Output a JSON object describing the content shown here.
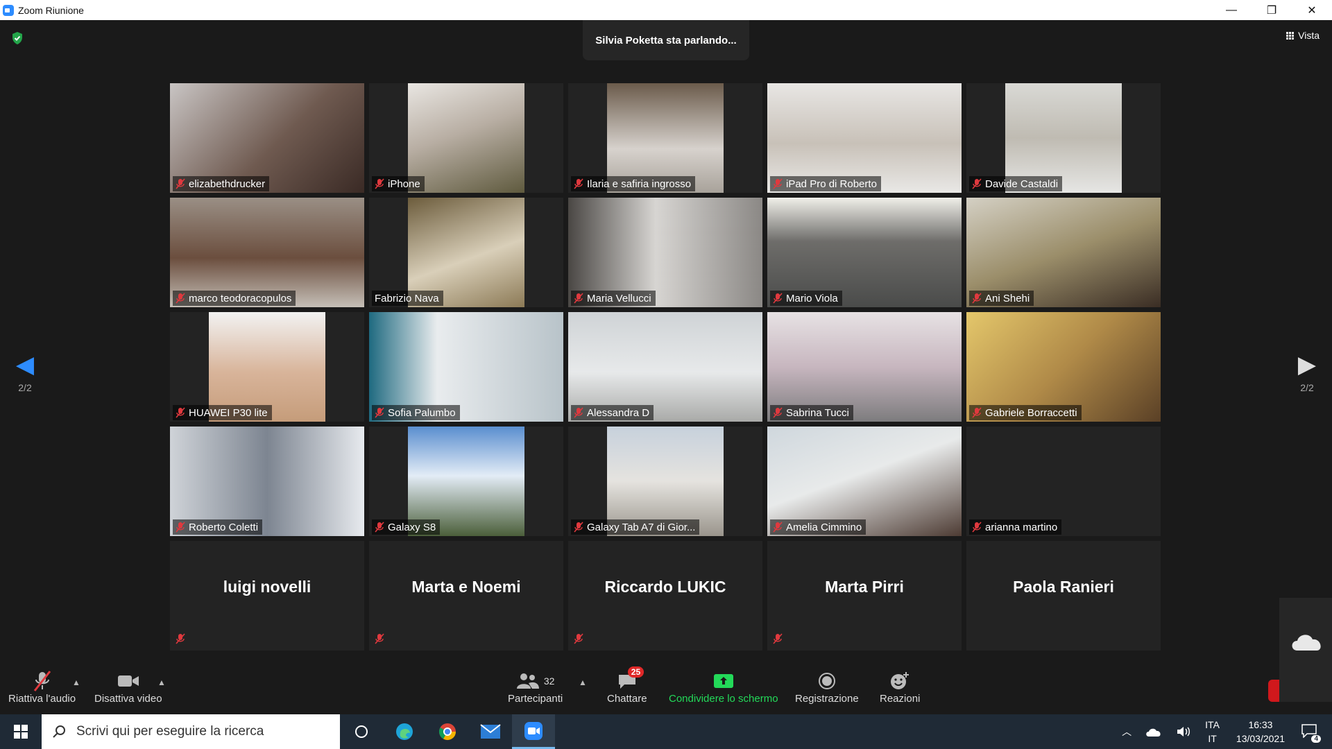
{
  "window": {
    "title": "Zoom Riunione",
    "controls": [
      "—",
      "❐",
      "✕"
    ]
  },
  "meeting": {
    "speaking_banner": "Silvia Poketta sta parlando...",
    "view_button": "Vista",
    "page_left": "2/2",
    "page_right": "2/2"
  },
  "tiles": [
    {
      "name": "elizabethdrucker",
      "muted": true,
      "video": true,
      "bg": "linear-gradient(135deg,#c9c5c4,#6f5a50 55%,#3a2a25)"
    },
    {
      "name": "iPhone",
      "muted": true,
      "video": true,
      "narrow": true,
      "bg": "linear-gradient(160deg,#e9e6e2,#b8aea3 45%,#5f5a3e)"
    },
    {
      "name": "Ilaria e safiria ingrosso",
      "muted": true,
      "video": true,
      "narrow": true,
      "bg": "linear-gradient(180deg,#6b5b4b,#d7d2cd 60%,#a8a29a)"
    },
    {
      "name": "iPad Pro di Roberto",
      "muted": true,
      "video": true,
      "bg": "linear-gradient(180deg,#e8e6e4,#c8c1b8 55%,#e9e8e6)"
    },
    {
      "name": "Davide Castaldi",
      "muted": true,
      "video": true,
      "narrow": true,
      "bg": "linear-gradient(180deg,#d9d9d5,#bfbbb2 50%,#e6e6e4)"
    },
    {
      "name": "marco teodoracopulos",
      "muted": true,
      "video": true,
      "bg": "linear-gradient(180deg,#9a8f85,#6b4e3e 55%,#c5bfb7)"
    },
    {
      "name": "Fabrizio Nava",
      "muted": false,
      "video": true,
      "narrow": true,
      "bg": "linear-gradient(160deg,#6c5c3c,#d9cfb9 55%,#8c7a56)"
    },
    {
      "name": "Maria Vellucci",
      "muted": true,
      "video": true,
      "bg": "linear-gradient(90deg,#4a4744,#d7d5d2 45%,#8b8885)"
    },
    {
      "name": "Mario Viola",
      "muted": true,
      "video": true,
      "bg": "linear-gradient(180deg,#f0efe9,#6e6d6a 40%,#4a4b4a)"
    },
    {
      "name": "Ani Shehi",
      "muted": true,
      "video": true,
      "bg": "linear-gradient(160deg,#d4d0c4,#9b8e6a 50%,#3a2d24)"
    },
    {
      "name": "HUAWEI P30 lite",
      "muted": true,
      "video": true,
      "narrow": true,
      "bg": "linear-gradient(180deg,#f2f2f2,#d8b49a 55%,#c59c7a)"
    },
    {
      "name": "Sofia Palumbo",
      "muted": true,
      "video": true,
      "bg": "linear-gradient(90deg,#1f6a80,#e9ecee 35%,#b8c3c9)"
    },
    {
      "name": "Alessandra D",
      "muted": true,
      "video": true,
      "bg": "linear-gradient(180deg,#cfd3d6,#e7e9ea 55%,#a9aaa8)"
    },
    {
      "name": "Sabrina Tucci",
      "muted": true,
      "video": true,
      "bg": "linear-gradient(180deg,#e7e2e4,#c7b6bf 50%,#7d7c7e)"
    },
    {
      "name": "Gabriele Borraccetti",
      "muted": true,
      "video": true,
      "bg": "linear-gradient(135deg,#e4c76b,#b08a48 50%,#5a4026)"
    },
    {
      "name": "Roberto Coletti",
      "muted": true,
      "video": true,
      "bg": "linear-gradient(90deg,#cfd3d8,#7d8591 50%,#e7eaee)"
    },
    {
      "name": "Galaxy S8",
      "muted": true,
      "video": true,
      "narrow": true,
      "bg": "linear-gradient(180deg,#5a8ecf,#e3ecf6 45%,#4b5f3a)"
    },
    {
      "name": "Galaxy Tab A7 di Gior...",
      "muted": true,
      "video": true,
      "narrow": true,
      "bg": "linear-gradient(180deg,#c7d1dc,#e5e3df 50%,#9a958c)"
    },
    {
      "name": "Amelia Cimmino",
      "muted": true,
      "video": true,
      "bg": "linear-gradient(160deg,#cfd7dd,#e8eaea 45%,#4d3b33)"
    },
    {
      "name": "arianna martino",
      "muted": true,
      "video": false,
      "bg": "#232323"
    },
    {
      "name": "luigi novelli",
      "muted": true,
      "video": false,
      "big": true
    },
    {
      "name": "Marta e Noemi",
      "muted": true,
      "video": false,
      "big": true
    },
    {
      "name": "Riccardo LUKIC",
      "muted": true,
      "video": false,
      "big": true
    },
    {
      "name": "Marta Pirri",
      "muted": true,
      "video": false,
      "big": true
    },
    {
      "name": "Paola Ranieri",
      "muted": false,
      "video": false,
      "big": true
    }
  ],
  "toolbar": {
    "audio": "Riattiva l'audio",
    "video": "Disattiva video",
    "participants": "Partecipanti",
    "participants_count": "32",
    "chat": "Chattare",
    "chat_badge": "25",
    "share": "Condividere lo schermo",
    "record": "Registrazione",
    "reactions": "Reazioni"
  },
  "taskbar": {
    "search_placeholder": "Scrivi qui per eseguire la ricerca",
    "lang_1": "ITA",
    "lang_2": "IT",
    "time": "16:33",
    "date": "13/03/2021",
    "notification_count": "4"
  },
  "colors": {
    "accent": "#2d8cff",
    "muted_red": "#e0393e",
    "share_green": "#23d959",
    "badge_red": "#e02828"
  }
}
